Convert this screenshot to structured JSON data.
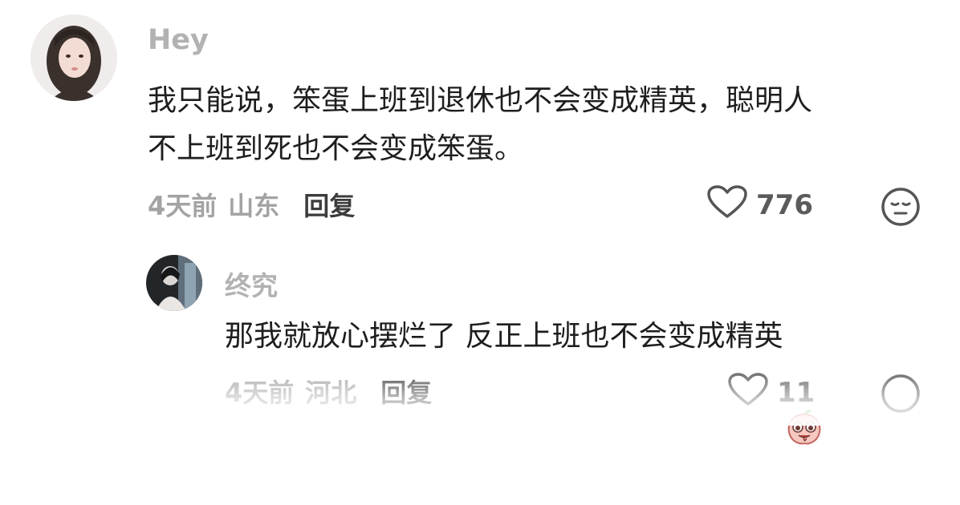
{
  "comments": [
    {
      "username": "Hey",
      "text": "我只能说，笨蛋上班到退休也不会变成精英，聪明人\n不上班到死也不会变成笨蛋。",
      "time": "4天前",
      "location": "山东",
      "reply_label": "回复",
      "like_count": "776"
    }
  ],
  "replies": [
    {
      "username": "终究",
      "text": "那我就放心摆烂了 反正上班也不会变成精英",
      "time": "4天前",
      "location": "河北",
      "reply_label": "回复",
      "like_count": "11",
      "emoji": "drooling-peach-emoji"
    }
  ],
  "icons": {
    "like": "heart-outline-icon",
    "react": "meh-face-icon"
  },
  "colors": {
    "username": "#b2b2b2",
    "text": "#1e1e1e",
    "meta": "#a3a3a3",
    "reply": "#3c3c3c",
    "icon": "#555555"
  }
}
